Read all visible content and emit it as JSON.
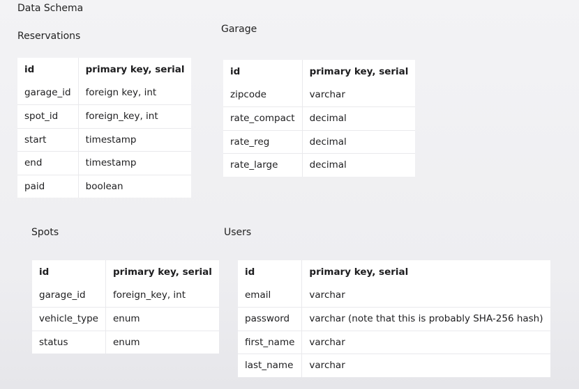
{
  "page_title": "Data Schema",
  "tables": {
    "reservations": {
      "title": "Reservations",
      "rows": [
        {
          "name": "id",
          "type": "primary key, serial"
        },
        {
          "name": "garage_id",
          "type": "foreign key, int"
        },
        {
          "name": "spot_id",
          "type": "foreign_key, int"
        },
        {
          "name": "start",
          "type": "timestamp"
        },
        {
          "name": "end",
          "type": "timestamp"
        },
        {
          "name": "paid",
          "type": "boolean"
        }
      ]
    },
    "garage": {
      "title": "Garage",
      "rows": [
        {
          "name": "id",
          "type": "primary key, serial"
        },
        {
          "name": "zipcode",
          "type": "varchar"
        },
        {
          "name": "rate_compact",
          "type": "decimal"
        },
        {
          "name": "rate_reg",
          "type": "decimal"
        },
        {
          "name": "rate_large",
          "type": "decimal"
        }
      ]
    },
    "spots": {
      "title": "Spots",
      "rows": [
        {
          "name": "id",
          "type": "primary key, serial"
        },
        {
          "name": "garage_id",
          "type": "foreign_key, int"
        },
        {
          "name": "vehicle_type",
          "type": "enum"
        },
        {
          "name": "status",
          "type": "enum"
        }
      ]
    },
    "users": {
      "title": "Users",
      "rows": [
        {
          "name": "id",
          "type": "primary key, serial"
        },
        {
          "name": "email",
          "type": "varchar"
        },
        {
          "name": "password",
          "type": "varchar (note that this is probably SHA-256 hash)"
        },
        {
          "name": "first_name",
          "type": "varchar"
        },
        {
          "name": "last_name",
          "type": "varchar"
        }
      ]
    }
  }
}
